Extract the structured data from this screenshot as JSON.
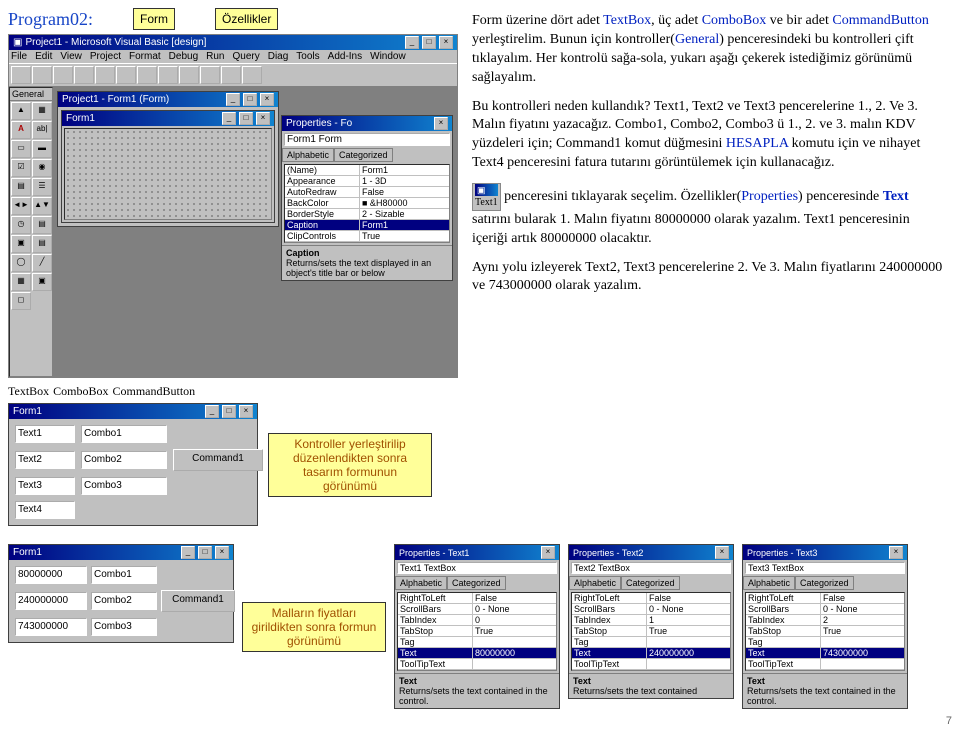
{
  "header": {
    "program": "Program02:",
    "callout_form": "Form",
    "callout_props": "Özellikler"
  },
  "vb_main": {
    "title": "Project1 - Microsoft Visual Basic [design]",
    "menu": [
      "File",
      "Edit",
      "View",
      "Project",
      "Format",
      "Debug",
      "Run",
      "Query",
      "Diag",
      "Tools",
      "Add-Ins",
      "Window"
    ],
    "toolbox_label": "General"
  },
  "design_form_window": {
    "title": "Project1 - Form1 (Form)",
    "inner_title": "Form1"
  },
  "properties1": {
    "title": "Properties - Fo",
    "combo": "Form1 Form",
    "tab1": "Alphabetic",
    "tab2": "Categorized",
    "rows": [
      {
        "k": "(Name)",
        "v": "Form1"
      },
      {
        "k": "Appearance",
        "v": "1 - 3D"
      },
      {
        "k": "AutoRedraw",
        "v": "False"
      },
      {
        "k": "BackColor",
        "v": "■ &H80000"
      },
      {
        "k": "BorderStyle",
        "v": "2 - Sizable"
      },
      {
        "k": "Caption",
        "v": "Form1"
      },
      {
        "k": "ClipControls",
        "v": "True"
      }
    ],
    "desc_title": "Caption",
    "desc_body": "Returns/sets the text displayed in an object's title bar or below"
  },
  "under_labels": {
    "textbox": "TextBox",
    "combobox": "ComboBox",
    "commandbutton": "CommandButton"
  },
  "form_design1": {
    "title": "Form1",
    "text1": "Text1",
    "combo1": "Combo1",
    "text2": "Text2",
    "combo2": "Combo2",
    "cmd1": "Command1",
    "text3": "Text3",
    "combo3": "Combo3",
    "text4": "Text4"
  },
  "callout_mid": "Kontroller yerleştirilip düzenlendikten sonra tasarım formunun görünümü",
  "rt": {
    "p1a": "Form üzerine dört adet ",
    "p1_textbox": "TextBox",
    "p1b": ", üç adet ",
    "p1_combobox": "ComboBox",
    "p1c": " ve bir adet ",
    "p1_cmdbtn": "CommandButton",
    "p1d": " yerleştirelim. Bunun için kontroller(",
    "p1_general": "General",
    "p1e": ") penceresindeki bu kontrolleri çift tıklayalım. Her kontrolü sağa-sola, yukarı aşağı çekerek istediğimiz görünümü sağlayalım.",
    "p2a": "Bu kontrolleri neden kullandık? Text1, Text2 ve Text3 pencerelerine 1., 2. Ve 3. Malın fiyatını yazacağız. Combo1, Combo2, Combo3 ü 1., 2. ve 3. malın KDV yüzdeleri için; Command1 komut düğmesini ",
    "p2_hesapla": "HESAPLA",
    "p2b": " komutu için ve nihayet Text4 penceresini fatura tutarını görüntülemek için kullanacağız.",
    "inline_icon": "Text1",
    "p3a": " penceresini tıklayarak seçelim. Özellikler(",
    "p3_props": "Properties",
    "p3b": ") penceresinde ",
    "p3_text": "Text",
    "p3c": " satırını bularak 1. Malın fiyatını 80000000 olarak yazalım. Text1 penceresinin içeriği artık 80000000 olacaktır.",
    "p4": "Aynı yolu izleyerek Text2, Text3 pencerelerine 2. Ve 3. Malın fiyatlarını 240000000 ve 743000000 olarak yazalım."
  },
  "form_design2": {
    "title": "Form1",
    "v1": "80000000",
    "c1": "Combo1",
    "v2": "240000000",
    "c2": "Combo2",
    "cmd": "Command1",
    "v3": "743000000",
    "c3": "Combo3"
  },
  "callout_bottom": "Malların fiyatları girildikten sonra formun görünümü",
  "prop_text": {
    "alphabetic": "Alphabetic",
    "categorized": "Categorized",
    "desc_title": "Text"
  },
  "prop1": {
    "title": "Properties - Text1",
    "combo": "Text1 TextBox",
    "rows": [
      {
        "k": "RightToLeft",
        "v": "False"
      },
      {
        "k": "ScrollBars",
        "v": "0 - None"
      },
      {
        "k": "TabIndex",
        "v": "0"
      },
      {
        "k": "TabStop",
        "v": "True"
      },
      {
        "k": "Tag",
        "v": ""
      },
      {
        "k": "Text",
        "v": "80000000"
      },
      {
        "k": "ToolTipText",
        "v": ""
      }
    ],
    "desc": "Returns/sets the text contained in the control."
  },
  "prop2": {
    "title": "Properties - Text2",
    "combo": "Text2 TextBox",
    "rows": [
      {
        "k": "RightToLeft",
        "v": "False"
      },
      {
        "k": "ScrollBars",
        "v": "0 - None"
      },
      {
        "k": "TabIndex",
        "v": "1"
      },
      {
        "k": "TabStop",
        "v": "True"
      },
      {
        "k": "Tag",
        "v": ""
      },
      {
        "k": "Text",
        "v": "240000000"
      },
      {
        "k": "ToolTipText",
        "v": ""
      }
    ],
    "desc": "Returns/sets the text contained"
  },
  "prop3": {
    "title": "Properties - Text3",
    "combo": "Text3 TextBox",
    "rows": [
      {
        "k": "RightToLeft",
        "v": "False"
      },
      {
        "k": "ScrollBars",
        "v": "0 - None"
      },
      {
        "k": "TabIndex",
        "v": "2"
      },
      {
        "k": "TabStop",
        "v": "True"
      },
      {
        "k": "Tag",
        "v": ""
      },
      {
        "k": "Text",
        "v": "743000000"
      },
      {
        "k": "ToolTipText",
        "v": ""
      }
    ],
    "desc": "Returns/sets the text contained in the control."
  },
  "page_number": "7"
}
